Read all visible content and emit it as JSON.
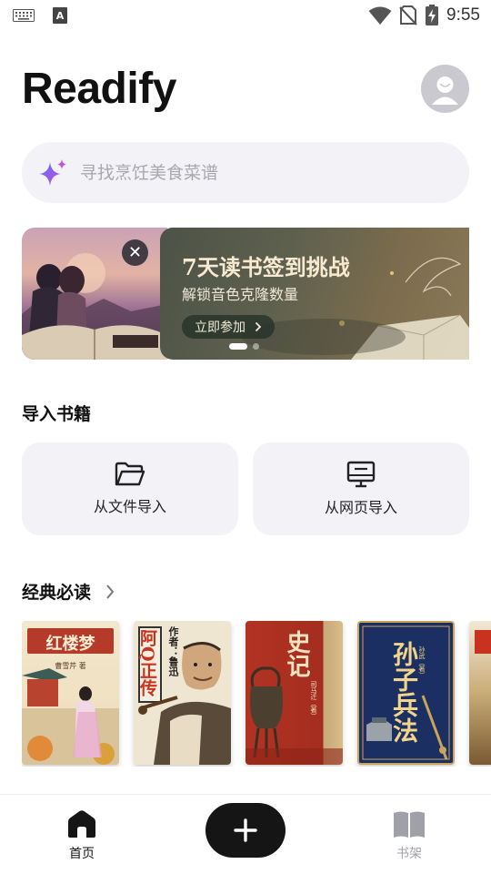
{
  "status_bar": {
    "time": "9:55",
    "icons": [
      "keyboard-icon",
      "a-icon",
      "wifi-icon",
      "no-sim-icon",
      "battery-charging-icon"
    ]
  },
  "header": {
    "app_title": "Readify",
    "avatar_icon": "avatar-icon"
  },
  "search": {
    "placeholder": "寻找烹饪美食菜谱",
    "icon": "sparkle-icon"
  },
  "banner": {
    "title": "7天读书签到挑战",
    "subtitle": "解锁音色克隆数量",
    "cta_label": "立即参加",
    "close_icon": "close-icon",
    "current_slide": 1,
    "slide_count": 2
  },
  "import_section": {
    "title": "导入书籍",
    "cards": [
      {
        "label": "从文件导入",
        "icon": "folder-open-icon"
      },
      {
        "label": "从网页导入",
        "icon": "monitor-icon"
      }
    ]
  },
  "classics_section": {
    "title": "经典必读",
    "more_icon": "chevron-right-icon",
    "books": [
      {
        "cover_title": "红楼梦",
        "cover_author": "曹雪芹 著"
      },
      {
        "cover_title": "阿Q正传",
        "cover_author": "作者：鲁迅"
      },
      {
        "cover_title": "史记",
        "cover_author": "司马迁（著）"
      },
      {
        "cover_title": "孙子兵法",
        "cover_author": "孙武（著）"
      }
    ]
  },
  "bottom_nav": {
    "items": [
      {
        "label": "首页",
        "icon": "home-icon",
        "active": true
      },
      {
        "label": "书架",
        "icon": "book-open-icon",
        "active": false
      }
    ],
    "fab_icon": "plus-icon"
  },
  "colors": {
    "accent": "#151515",
    "surface": "#f3f3f7",
    "inactive": "#a0a0a8"
  }
}
